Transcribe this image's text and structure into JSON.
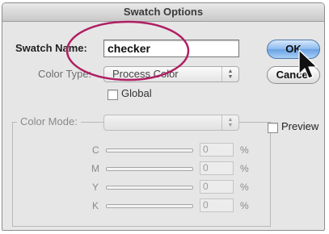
{
  "dialog": {
    "title": "Swatch Options"
  },
  "swatch_name": {
    "label": "Swatch Name:",
    "value": "checker"
  },
  "color_type": {
    "label": "Color Type:",
    "selected": "Process Color"
  },
  "global": {
    "label": "Global",
    "checked": false
  },
  "color_mode": {
    "label": "Color Mode:",
    "selected": ""
  },
  "channels": [
    {
      "label": "C",
      "value": "0",
      "unit": "%"
    },
    {
      "label": "M",
      "value": "0",
      "unit": "%"
    },
    {
      "label": "Y",
      "value": "0",
      "unit": "%"
    },
    {
      "label": "K",
      "value": "0",
      "unit": "%"
    }
  ],
  "buttons": {
    "ok": "OK",
    "cancel": "Cancel"
  },
  "preview": {
    "label": "Preview",
    "checked": false
  },
  "colors": {
    "annotation_ellipse": "#b01e62",
    "default_button": "#8fbcee"
  },
  "icons": {
    "cursor": "arrow-cursor-icon",
    "popup_stepper": "up-down-chevron-icon"
  }
}
